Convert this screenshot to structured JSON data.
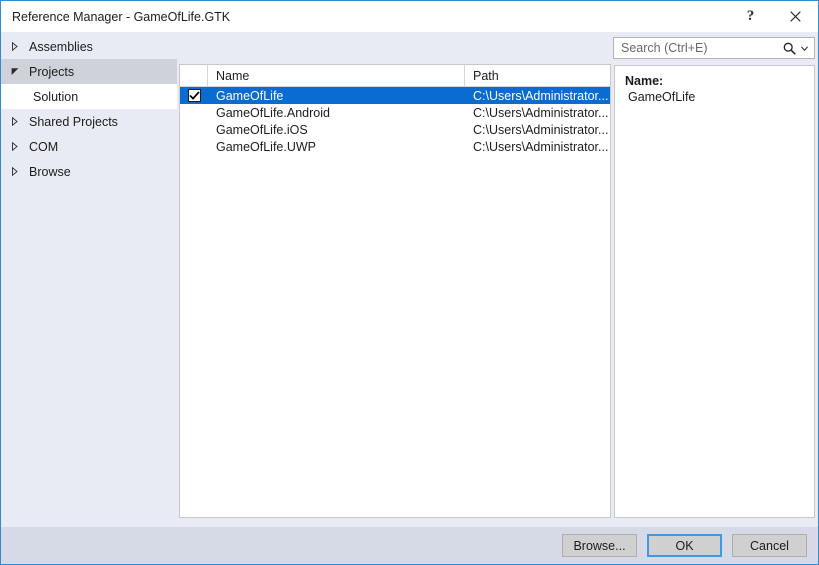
{
  "window": {
    "title": "Reference Manager - GameOfLife.GTK",
    "accent_color": "#2e8bd4",
    "selection_color": "#0a6bd0",
    "help_button_label": "?",
    "close_button_label": "×",
    "help_icon": "question-mark-icon",
    "close_icon": "close-icon"
  },
  "sidebar": {
    "items": [
      {
        "label": "Assemblies",
        "state": "collapsed",
        "level": 0,
        "selected": false
      },
      {
        "label": "Projects",
        "state": "expanded",
        "level": 0,
        "selected": false
      },
      {
        "label": "Solution",
        "state": "leaf",
        "level": 1,
        "selected": true
      },
      {
        "label": "Shared Projects",
        "state": "collapsed",
        "level": 0,
        "selected": false
      },
      {
        "label": "COM",
        "state": "collapsed",
        "level": 0,
        "selected": false
      },
      {
        "label": "Browse",
        "state": "collapsed",
        "level": 0,
        "selected": false
      }
    ]
  },
  "search": {
    "value": "",
    "placeholder": "Search (Ctrl+E)",
    "icon": "magnifier-icon",
    "dropdown_icon": "chevron-down-icon"
  },
  "list": {
    "columns": [
      "",
      "Name",
      "Path"
    ],
    "rows": [
      {
        "checked": true,
        "name": "GameOfLife",
        "path": "C:\\Users\\Administrator...",
        "selected": true
      },
      {
        "checked": false,
        "name": "GameOfLife.Android",
        "path": "C:\\Users\\Administrator...",
        "selected": false
      },
      {
        "checked": false,
        "name": "GameOfLife.iOS",
        "path": "C:\\Users\\Administrator...",
        "selected": false
      },
      {
        "checked": false,
        "name": "GameOfLife.UWP",
        "path": "C:\\Users\\Administrator...",
        "selected": false
      }
    ]
  },
  "details": {
    "name_label": "Name:",
    "name_value": "GameOfLife"
  },
  "footer": {
    "browse_label": "Browse...",
    "ok_label": "OK",
    "cancel_label": "Cancel"
  }
}
